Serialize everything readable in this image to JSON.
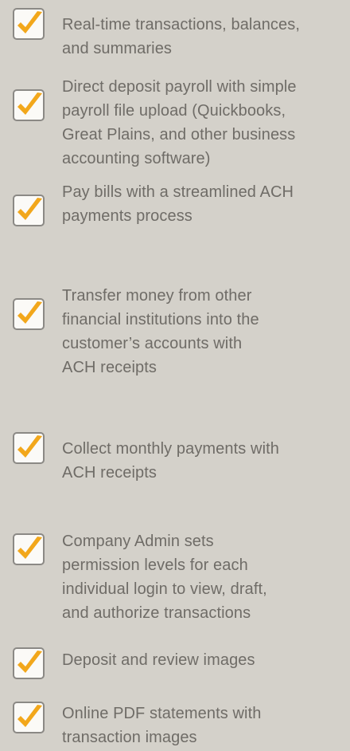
{
  "features": [
    {
      "icon": "checkmark-icon",
      "text": "Real-time transactions, balances,\nand summaries"
    },
    {
      "icon": "checkmark-icon",
      "text": "Direct deposit payroll with simple\npayroll file upload (Quickbooks,\nGreat Plains, and other business\naccounting software)"
    },
    {
      "icon": "checkmark-icon",
      "text": "Pay bills with a streamlined ACH\npayments process"
    },
    {
      "icon": "checkmark-icon",
      "text": "Transfer money from other\nfinancial institutions into the\ncustomer’s accounts with\nACH receipts"
    },
    {
      "icon": "checkmark-icon",
      "text": "Collect monthly payments with\nACH receipts"
    },
    {
      "icon": "checkmark-icon",
      "text": "Company Admin sets\npermission levels for each\nindividual login to view, draft,\nand authorize transactions"
    },
    {
      "icon": "checkmark-icon",
      "text": "Deposit and review images"
    },
    {
      "icon": "checkmark-icon",
      "text": "Online PDF statements with\ntransaction images"
    }
  ],
  "colors": {
    "background": "#d4d1ca",
    "text": "#6f6c67",
    "check": "#f2a71b",
    "box_fill": "#fbfaf7",
    "box_border": "#8b8985"
  }
}
